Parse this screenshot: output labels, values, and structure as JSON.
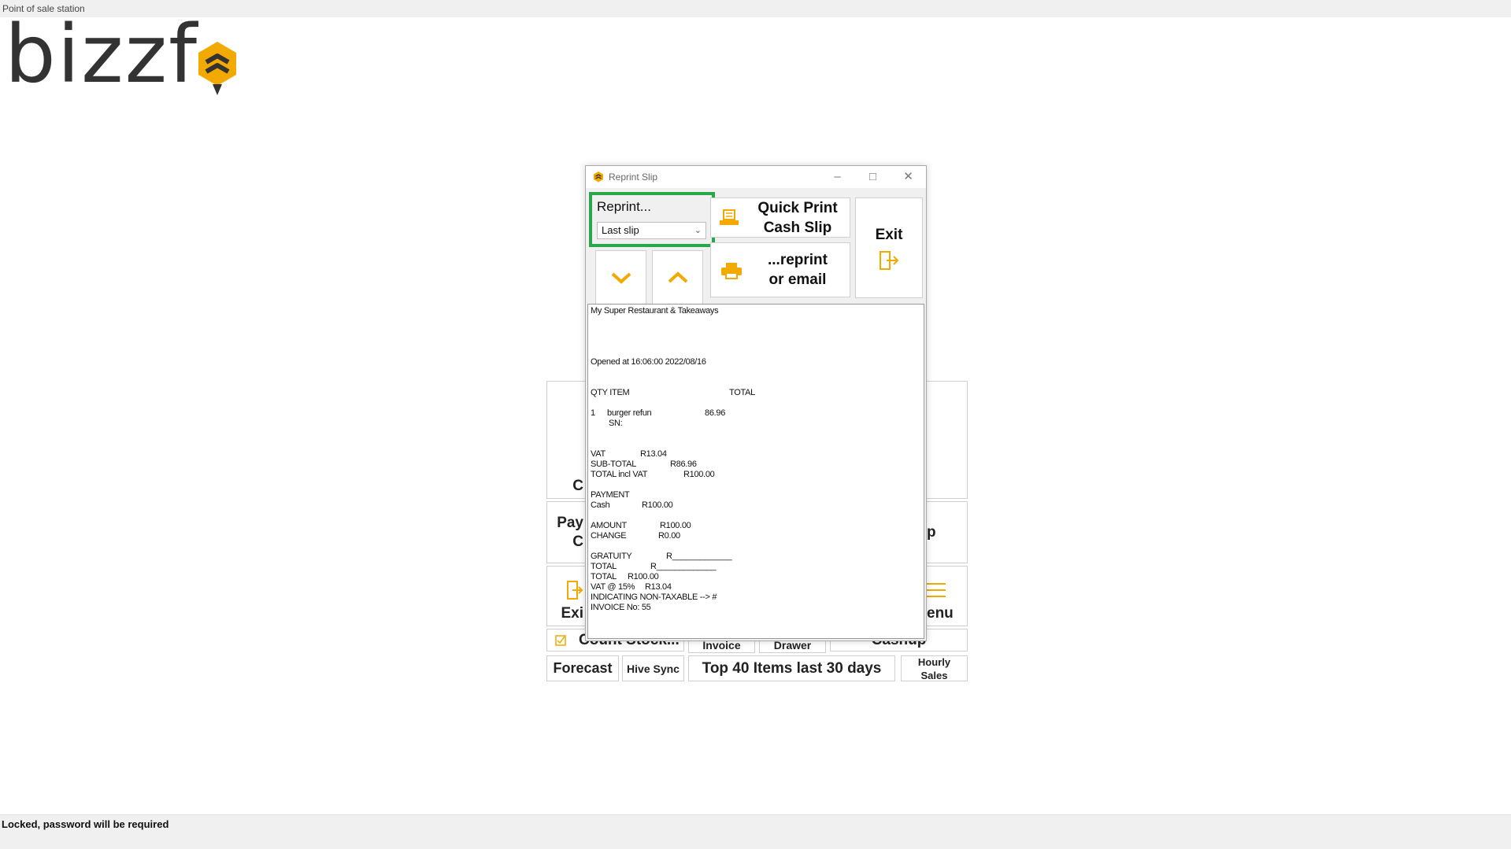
{
  "window": {
    "title": "Point of sale station"
  },
  "logo": {
    "text": "bizzf"
  },
  "status_bar": {
    "text": "Locked, password will be required"
  },
  "background": {
    "buttons": {
      "b1": "C",
      "b2a": "Pay",
      "b2b": "C",
      "b3": "Exi",
      "b4": "enu",
      "b5": "p",
      "count_stock": "Count Stock...",
      "invoice": "Invoice",
      "drawer": "Drawer",
      "cashup": "Cashup",
      "forecast": "Forecast",
      "hive_sync": "Hive Sync",
      "top40": "Top 40 Items last 30 days",
      "hourly1": "Hourly",
      "hourly2": "Sales"
    }
  },
  "dialog": {
    "title": "Reprint Slip",
    "reprint_label": "Reprint...",
    "reprint_select_value": "Last slip",
    "quick_print_line1": "Quick Print",
    "quick_print_line2": "Cash Slip",
    "reprint_email_line1": "...reprint",
    "reprint_email_line2": "or email",
    "exit_label": "Exit"
  },
  "slip": {
    "restaurant": "My Super Restaurant & Takeaways",
    "opened": "Opened at 16:06:00 2022/08/16",
    "col_qty_item": "QTY ITEM",
    "col_total": "TOTAL",
    "item_qty": "1",
    "item_name": "burger refun",
    "item_total": "86.96",
    "sn": "SN:",
    "vat_label": "VAT",
    "vat_value": "R13.04",
    "subtotal_label": "SUB-TOTAL",
    "subtotal_value": "R86.96",
    "total_incl_label": "TOTAL incl VAT",
    "total_incl_value": "R100.00",
    "payment_label": "PAYMENT",
    "cash_label": "Cash",
    "cash_value": "R100.00",
    "amount_label": "AMOUNT",
    "amount_value": "R100.00",
    "change_label": "CHANGE",
    "change_value": "R0.00",
    "gratuity_label": "GRATUITY",
    "gratuity_value": "R_____________",
    "total2_label": "TOTAL",
    "total2_value": "R_____________",
    "total3_label": "TOTAL",
    "total3_value": "R100.00",
    "vat15_label": "VAT @ 15%",
    "vat15_value": "R13.04",
    "non_taxable": "INDICATING NON-TAXABLE --> #",
    "invoice_no": "INVOICE No: 55"
  },
  "colors": {
    "accent": "#f2a900",
    "highlight": "#29a84a",
    "logo_text": "#333333"
  }
}
